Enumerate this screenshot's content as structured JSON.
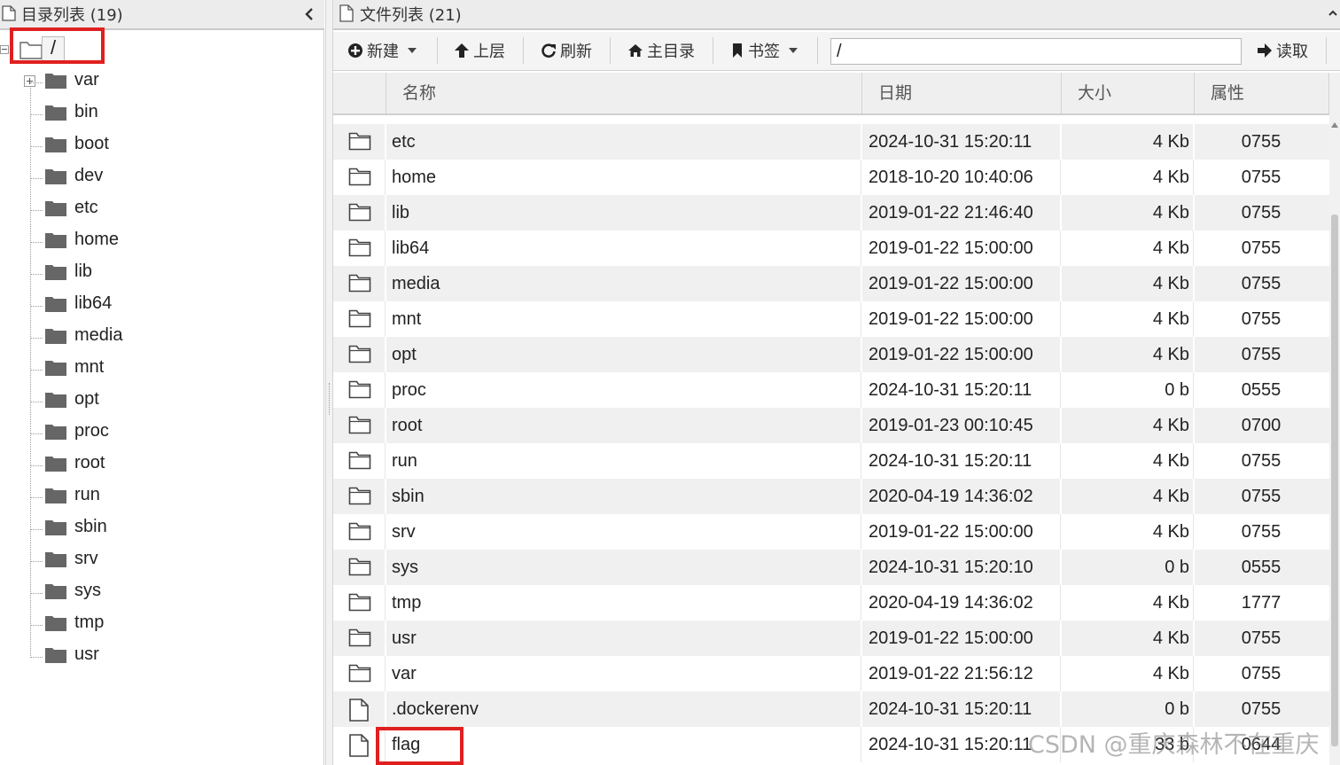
{
  "left_panel": {
    "title": "目录列表 (19)",
    "root_label": "/",
    "tree_items": [
      {
        "label": "var"
      },
      {
        "label": "bin"
      },
      {
        "label": "boot"
      },
      {
        "label": "dev"
      },
      {
        "label": "etc"
      },
      {
        "label": "home"
      },
      {
        "label": "lib"
      },
      {
        "label": "lib64"
      },
      {
        "label": "media"
      },
      {
        "label": "mnt"
      },
      {
        "label": "opt"
      },
      {
        "label": "proc"
      },
      {
        "label": "root"
      },
      {
        "label": "run"
      },
      {
        "label": "sbin"
      },
      {
        "label": "srv"
      },
      {
        "label": "sys"
      },
      {
        "label": "tmp"
      },
      {
        "label": "usr"
      }
    ]
  },
  "right_panel": {
    "title": "文件列表 (21)",
    "toolbar": {
      "new_label": "新建",
      "up_label": "上层",
      "refresh_label": "刷新",
      "home_label": "主目录",
      "bookmark_label": "书签",
      "path_value": "/",
      "read_label": "读取"
    },
    "columns": {
      "name": "名称",
      "date": "日期",
      "size": "大小",
      "attr": "属性"
    },
    "rows": [
      {
        "type": "folder",
        "name": "etc",
        "date": "2024-10-31 15:20:11",
        "size": "4 Kb",
        "attr": "0755"
      },
      {
        "type": "folder",
        "name": "home",
        "date": "2018-10-20 10:40:06",
        "size": "4 Kb",
        "attr": "0755"
      },
      {
        "type": "folder",
        "name": "lib",
        "date": "2019-01-22 21:46:40",
        "size": "4 Kb",
        "attr": "0755"
      },
      {
        "type": "folder",
        "name": "lib64",
        "date": "2019-01-22 15:00:00",
        "size": "4 Kb",
        "attr": "0755"
      },
      {
        "type": "folder",
        "name": "media",
        "date": "2019-01-22 15:00:00",
        "size": "4 Kb",
        "attr": "0755"
      },
      {
        "type": "folder",
        "name": "mnt",
        "date": "2019-01-22 15:00:00",
        "size": "4 Kb",
        "attr": "0755"
      },
      {
        "type": "folder",
        "name": "opt",
        "date": "2019-01-22 15:00:00",
        "size": "4 Kb",
        "attr": "0755"
      },
      {
        "type": "folder",
        "name": "proc",
        "date": "2024-10-31 15:20:11",
        "size": "0 b",
        "attr": "0555"
      },
      {
        "type": "folder",
        "name": "root",
        "date": "2019-01-23 00:10:45",
        "size": "4 Kb",
        "attr": "0700"
      },
      {
        "type": "folder",
        "name": "run",
        "date": "2024-10-31 15:20:11",
        "size": "4 Kb",
        "attr": "0755"
      },
      {
        "type": "folder",
        "name": "sbin",
        "date": "2020-04-19 14:36:02",
        "size": "4 Kb",
        "attr": "0755"
      },
      {
        "type": "folder",
        "name": "srv",
        "date": "2019-01-22 15:00:00",
        "size": "4 Kb",
        "attr": "0755"
      },
      {
        "type": "folder",
        "name": "sys",
        "date": "2024-10-31 15:20:10",
        "size": "0 b",
        "attr": "0555"
      },
      {
        "type": "folder",
        "name": "tmp",
        "date": "2020-04-19 14:36:02",
        "size": "4 Kb",
        "attr": "1777"
      },
      {
        "type": "folder",
        "name": "usr",
        "date": "2019-01-22 15:00:00",
        "size": "4 Kb",
        "attr": "0755"
      },
      {
        "type": "folder",
        "name": "var",
        "date": "2019-01-22 21:56:12",
        "size": "4 Kb",
        "attr": "0755"
      },
      {
        "type": "file",
        "name": ".dockerenv",
        "date": "2024-10-31 15:20:11",
        "size": "0 b",
        "attr": "0755"
      },
      {
        "type": "file",
        "name": "flag",
        "date": "2024-10-31 15:20:11",
        "size": "33 b",
        "attr": "0644"
      }
    ]
  },
  "watermark": "CSDN @重庆森林不在重庆",
  "colors": {
    "highlight": "#e02020",
    "header_bg": "#ececec",
    "row_alt_bg": "#f0f0f0",
    "folder_icon": "#666666"
  },
  "icons": {
    "panel_header": "page-icon",
    "collapse": "chevron-left-icon",
    "folder_tree": "folder-filled-icon",
    "folder_row": "folder-outline-icon",
    "file_row": "file-outline-icon",
    "new": "plus-circle-icon",
    "up": "arrow-up-icon",
    "refresh": "refresh-icon",
    "home": "home-icon",
    "bookmark": "bookmark-icon",
    "read": "arrow-right-icon"
  }
}
